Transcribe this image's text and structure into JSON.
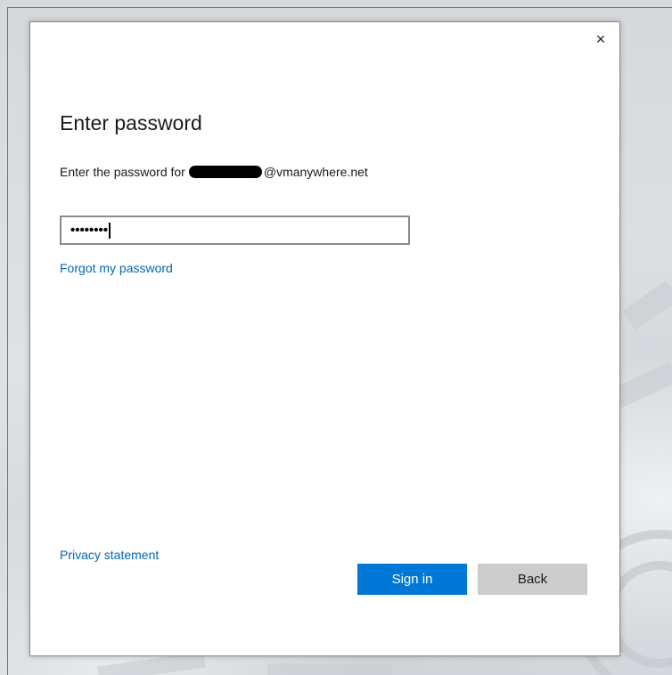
{
  "dialog": {
    "close_glyph": "×",
    "title": "Enter password",
    "subtitle_prefix": "Enter the password for",
    "subtitle_suffix": "@vmanywhere.net",
    "password_value": "••••••••",
    "forgot_link": "Forgot my password",
    "privacy_link": "Privacy statement",
    "signin_label": "Sign in",
    "back_label": "Back"
  },
  "colors": {
    "accent": "#0078d7",
    "link": "#0067b8",
    "secondary_button": "#cccccc"
  },
  "icons": {
    "close": "close-icon"
  }
}
